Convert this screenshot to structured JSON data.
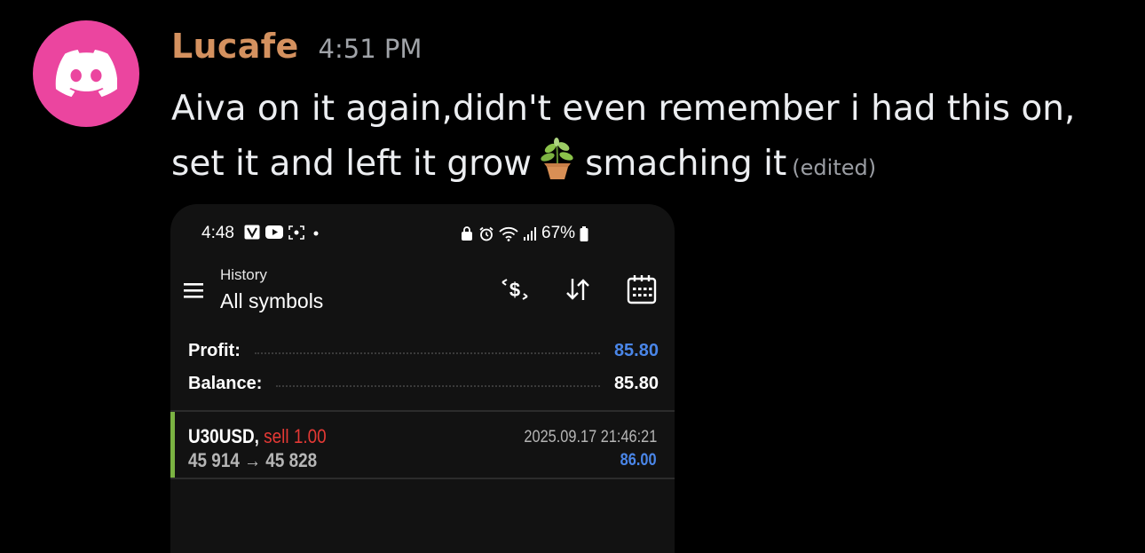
{
  "message": {
    "username": "Lucafe",
    "timestamp": "4:51 PM",
    "text_line1": "Aiva on it again,didn't even remember i had this on,",
    "text_line2_before": "set it and left it grow",
    "emoji_icon": "potted-plant-emoji",
    "text_line2_after": "smaching it",
    "edited_label": "(edited)",
    "avatar_icon": "discord-logo-icon",
    "colors": {
      "avatar_bg": "#eb459f",
      "username": "#d4915f",
      "background": "#000000"
    }
  },
  "attachment": {
    "status_bar": {
      "time": "4:48",
      "battery": "67%"
    },
    "app_bar": {
      "subtitle": "History",
      "title": "All symbols",
      "icons": [
        "menu-icon",
        "deposit-dollar-icon",
        "sort-icon",
        "calendar-icon"
      ]
    },
    "summary": {
      "profit_label": "Profit:",
      "profit_value": "85.80",
      "balance_label": "Balance:",
      "balance_value": "85.80"
    },
    "trade": {
      "symbol": "U30USD,",
      "side": "sell 1.00",
      "prices": "45 914 → 45 828",
      "datetime": "2025.09.17 21:46:21",
      "profit": "86.00"
    },
    "colors": {
      "profit_blue": "#4a86e8",
      "sell_red": "#e53935",
      "accent_green": "#7bb342"
    }
  }
}
